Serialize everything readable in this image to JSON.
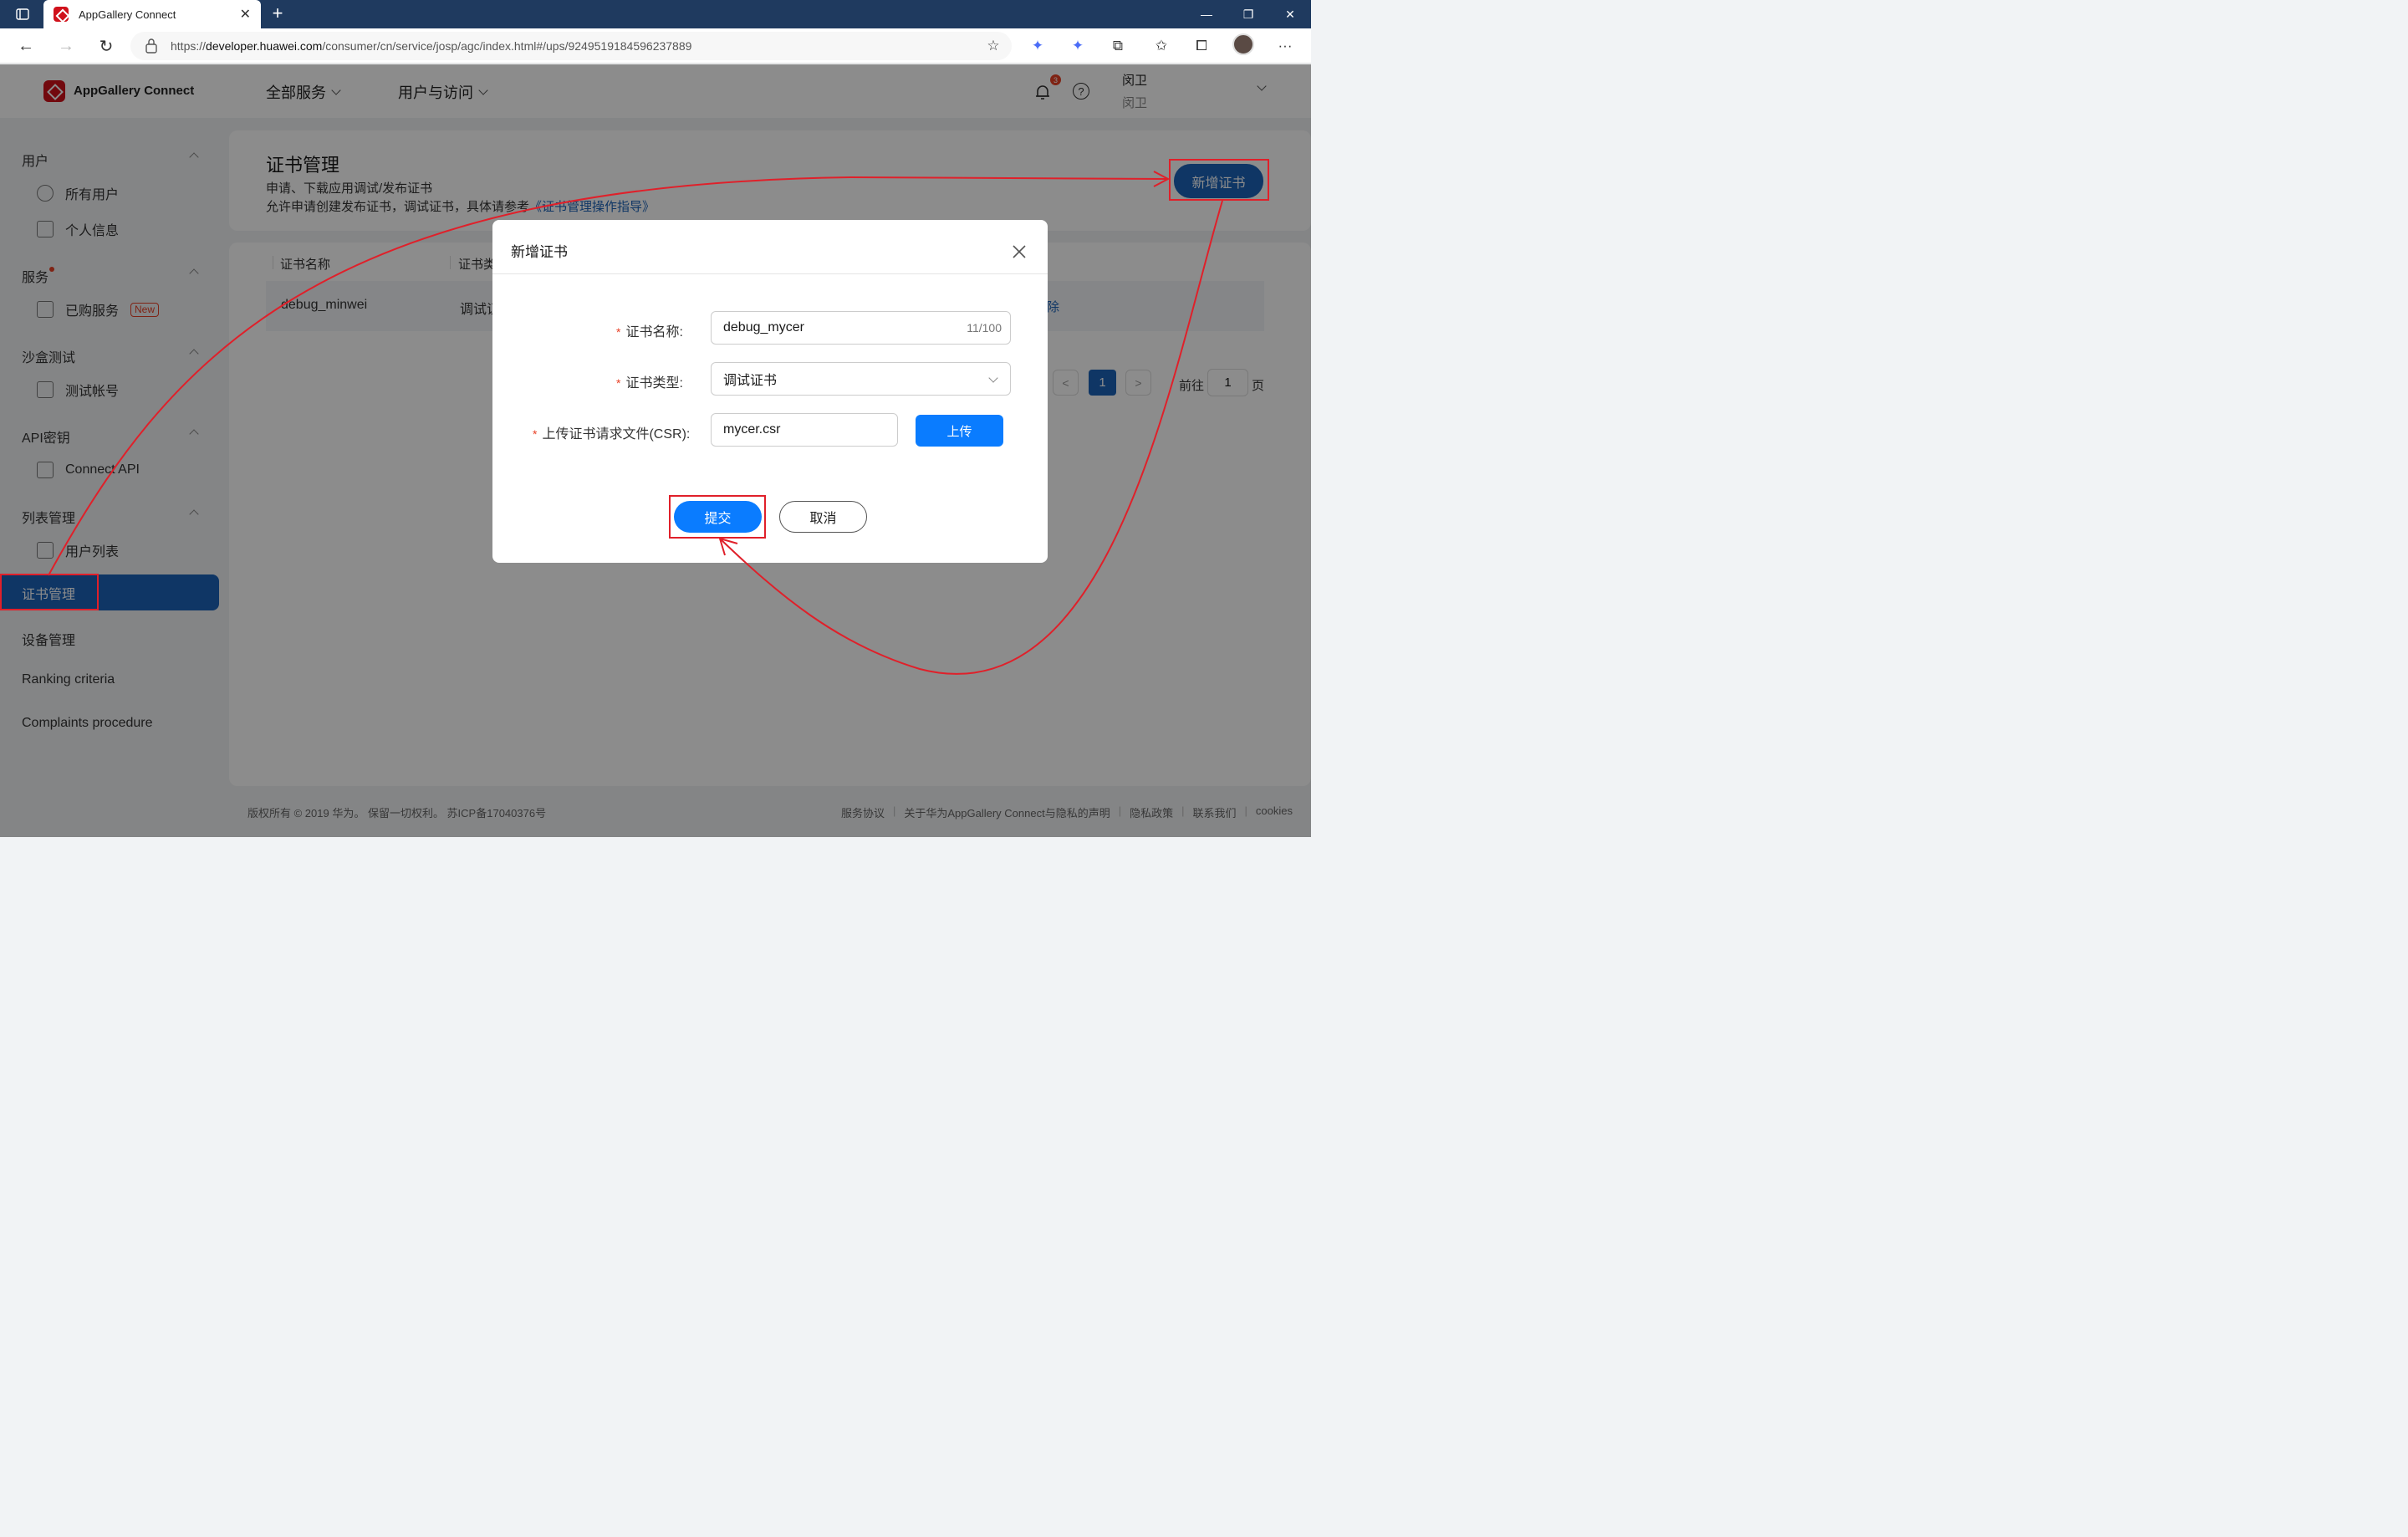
{
  "browser": {
    "tab_title": "AppGallery Connect",
    "url_prefix": "https://",
    "url_host": "developer.huawei.com",
    "url_path": "/consumer/cn/service/josp/agc/index.html#/ups/9249519184596237889"
  },
  "header": {
    "brand": "AppGallery Connect",
    "nav": [
      "全部服务",
      "用户与访问"
    ],
    "notification_count": "3",
    "help_symbol": "?",
    "user_name": "闵卫",
    "user_sub": "闵卫"
  },
  "sidebar": {
    "sections": [
      {
        "title": "用户",
        "items": [
          "所有用户",
          "个人信息"
        ]
      },
      {
        "title": "服务",
        "items": [
          "已购服务"
        ],
        "new_tag": "New"
      },
      {
        "title": "沙盒测试",
        "items": [
          "测试帐号"
        ]
      },
      {
        "title": "API密钥",
        "items": [
          "Connect API"
        ]
      },
      {
        "title": "列表管理",
        "items": [
          "用户列表"
        ]
      }
    ],
    "active": "证书管理",
    "plain_items": [
      "设备管理",
      "Ranking criteria",
      "Complaints procedure"
    ]
  },
  "page": {
    "title": "证书管理",
    "desc1": "申请、下载应用调试/发布证书",
    "desc2_prefix": "允许申请创建发布证书，调试证书，具体请参考",
    "desc2_link": "《证书管理操作指导》",
    "add_button": "新增证书"
  },
  "table": {
    "headers": [
      "证书名称",
      "证书类"
    ],
    "rows": [
      {
        "name": "debug_minwei",
        "type": "调试证",
        "action": "除"
      }
    ]
  },
  "pagination": {
    "prev": "<",
    "current": "1",
    "next": ">",
    "goto_label": "前往",
    "goto_value": "1",
    "goto_suffix": "页"
  },
  "dialog": {
    "title": "新增证书",
    "required_mark": "*",
    "fields": {
      "name_label": "证书名称:",
      "name_value": "debug_mycer",
      "name_counter": "11/100",
      "type_label": "证书类型:",
      "type_value": "调试证书",
      "csr_label": "上传证书请求文件(CSR):",
      "csr_value": "mycer.csr"
    },
    "upload_button": "上传",
    "submit_button": "提交",
    "cancel_button": "取消"
  },
  "footer": {
    "copyright": "版权所有 © 2019 华为。 保留一切权利。 苏ICP备17040376号",
    "links": [
      "服务协议",
      "关于华为AppGallery Connect与隐私的声明",
      "隐私政策",
      "联系我们",
      "cookies"
    ]
  },
  "colors": {
    "brand_blue": "#1c63b8",
    "button_blue": "#0a7cff",
    "annotation_red": "#e0202a",
    "huawei_red": "#d0111b"
  }
}
